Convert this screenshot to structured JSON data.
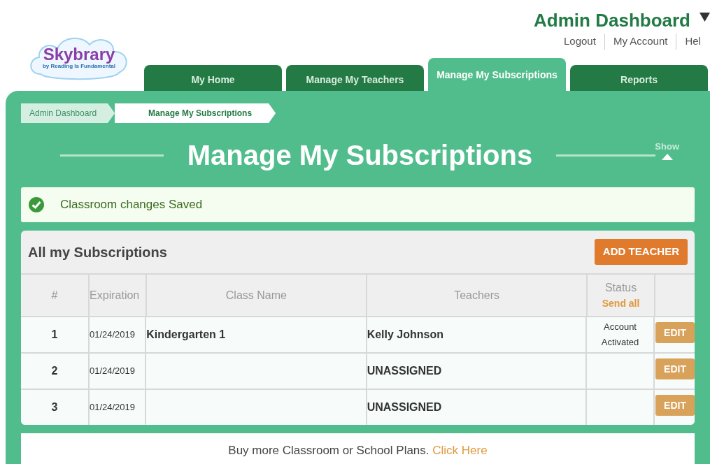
{
  "header": {
    "title": "Admin Dashboard",
    "links": [
      "Logout",
      "My Account",
      "Hel"
    ]
  },
  "logo": {
    "name": "Skybrary",
    "tagline": "by Reading Is Fundamental"
  },
  "tabs": [
    {
      "label": "My Home",
      "selected": false
    },
    {
      "label": "Manage My Teachers",
      "selected": false
    },
    {
      "label": "Manage My Subscriptions",
      "selected": true
    },
    {
      "label": "Reports",
      "selected": false
    }
  ],
  "breadcrumb": [
    {
      "label": "Admin Dashboard",
      "selected": false
    },
    {
      "label": "Manage My Subscriptions",
      "selected": true
    }
  ],
  "page_title": "Manage My Subscriptions",
  "toggle": {
    "label": "Show"
  },
  "message": "Classroom changes Saved",
  "card": {
    "title": "All my Subscriptions",
    "button": "ADD TEACHER"
  },
  "table": {
    "columns": [
      "#",
      "Expiration",
      "Class Name",
      "Teachers",
      "Status"
    ],
    "status_link": "Send all",
    "rows": [
      {
        "number": "1",
        "expiration": "01/24/2019",
        "class_name": "Kindergarten 1",
        "teacher": "Kelly Johnson",
        "status": "Account Activated",
        "action": "EDIT"
      },
      {
        "number": "2",
        "expiration": "01/24/2019",
        "teacher": "UNASSIGNED",
        "action": "EDIT"
      },
      {
        "number": "3",
        "expiration": "01/24/2019",
        "teacher": "UNASSIGNED",
        "action": "EDIT"
      }
    ]
  },
  "footer": {
    "text": "Buy more Classroom or School Plans.",
    "link": "Click Here"
  }
}
